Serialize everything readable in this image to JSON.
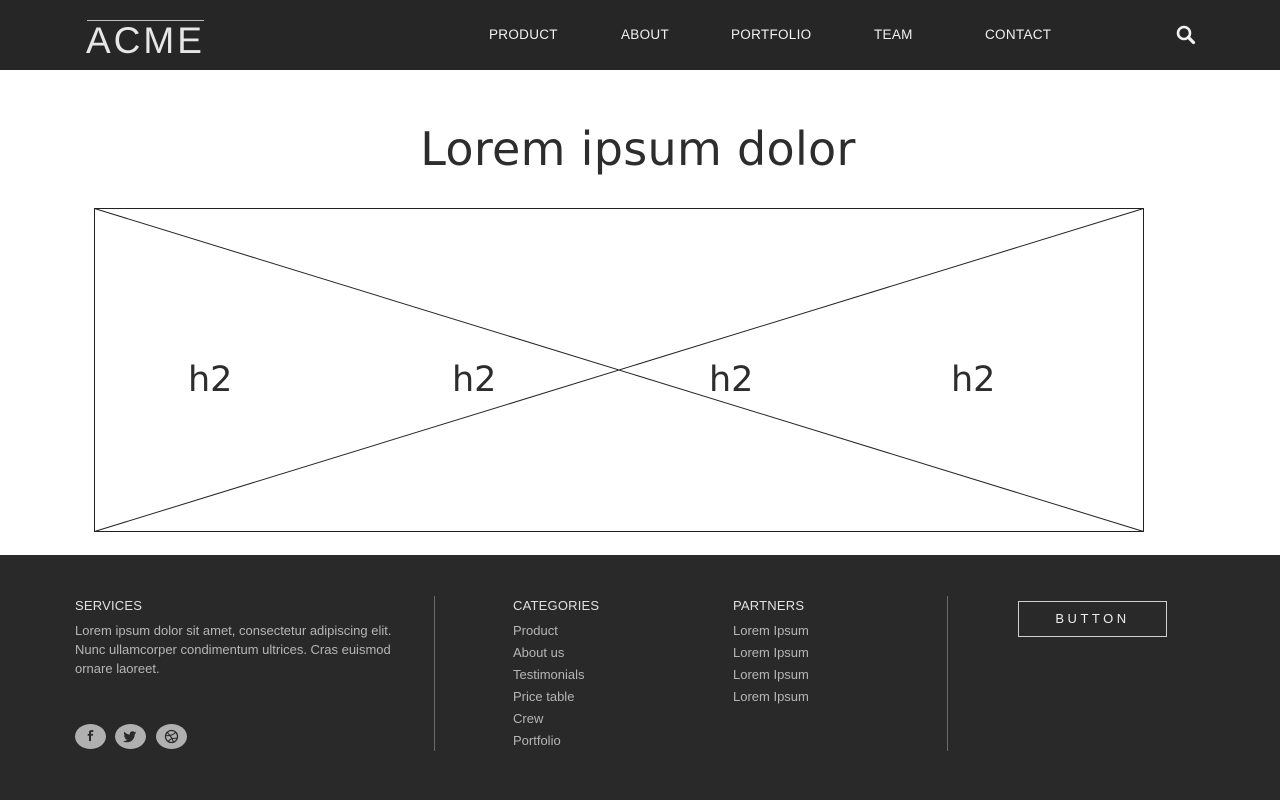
{
  "header": {
    "logo": "ACME",
    "nav": [
      "PRODUCT",
      "ABOUT",
      "PORTFOLIO",
      "TEAM",
      "CONTACT"
    ],
    "search_icon": "search-icon"
  },
  "main": {
    "title": "Lorem ipsum dolor",
    "placeholder_labels": [
      "h2",
      "h2",
      "h2",
      "h2"
    ]
  },
  "footer": {
    "services": {
      "heading": "SERVICES",
      "text": "Lorem ipsum dolor sit amet, consectetur adipiscing elit. Nunc ullamcorper condimentum ultrices. Cras euismod ornare laoreet.",
      "social_icons": [
        "facebook-icon",
        "twitter-icon",
        "dribbble-icon"
      ]
    },
    "categories": {
      "heading": "CATEGORIES",
      "links": [
        "Product",
        "About us",
        "Testimonials",
        "Price table",
        "Crew",
        "Portfolio"
      ]
    },
    "partners": {
      "heading": "PARTNERS",
      "links": [
        "Lorem Ipsum",
        "Lorem Ipsum",
        "Lorem Ipsum",
        "Lorem Ipsum"
      ]
    },
    "button_label": "BUTTON"
  },
  "colors": {
    "header_bg": "#262626",
    "footer_bg": "#292929",
    "text_dark": "#2d2d2d",
    "footer_text": "#b5b5b5"
  }
}
